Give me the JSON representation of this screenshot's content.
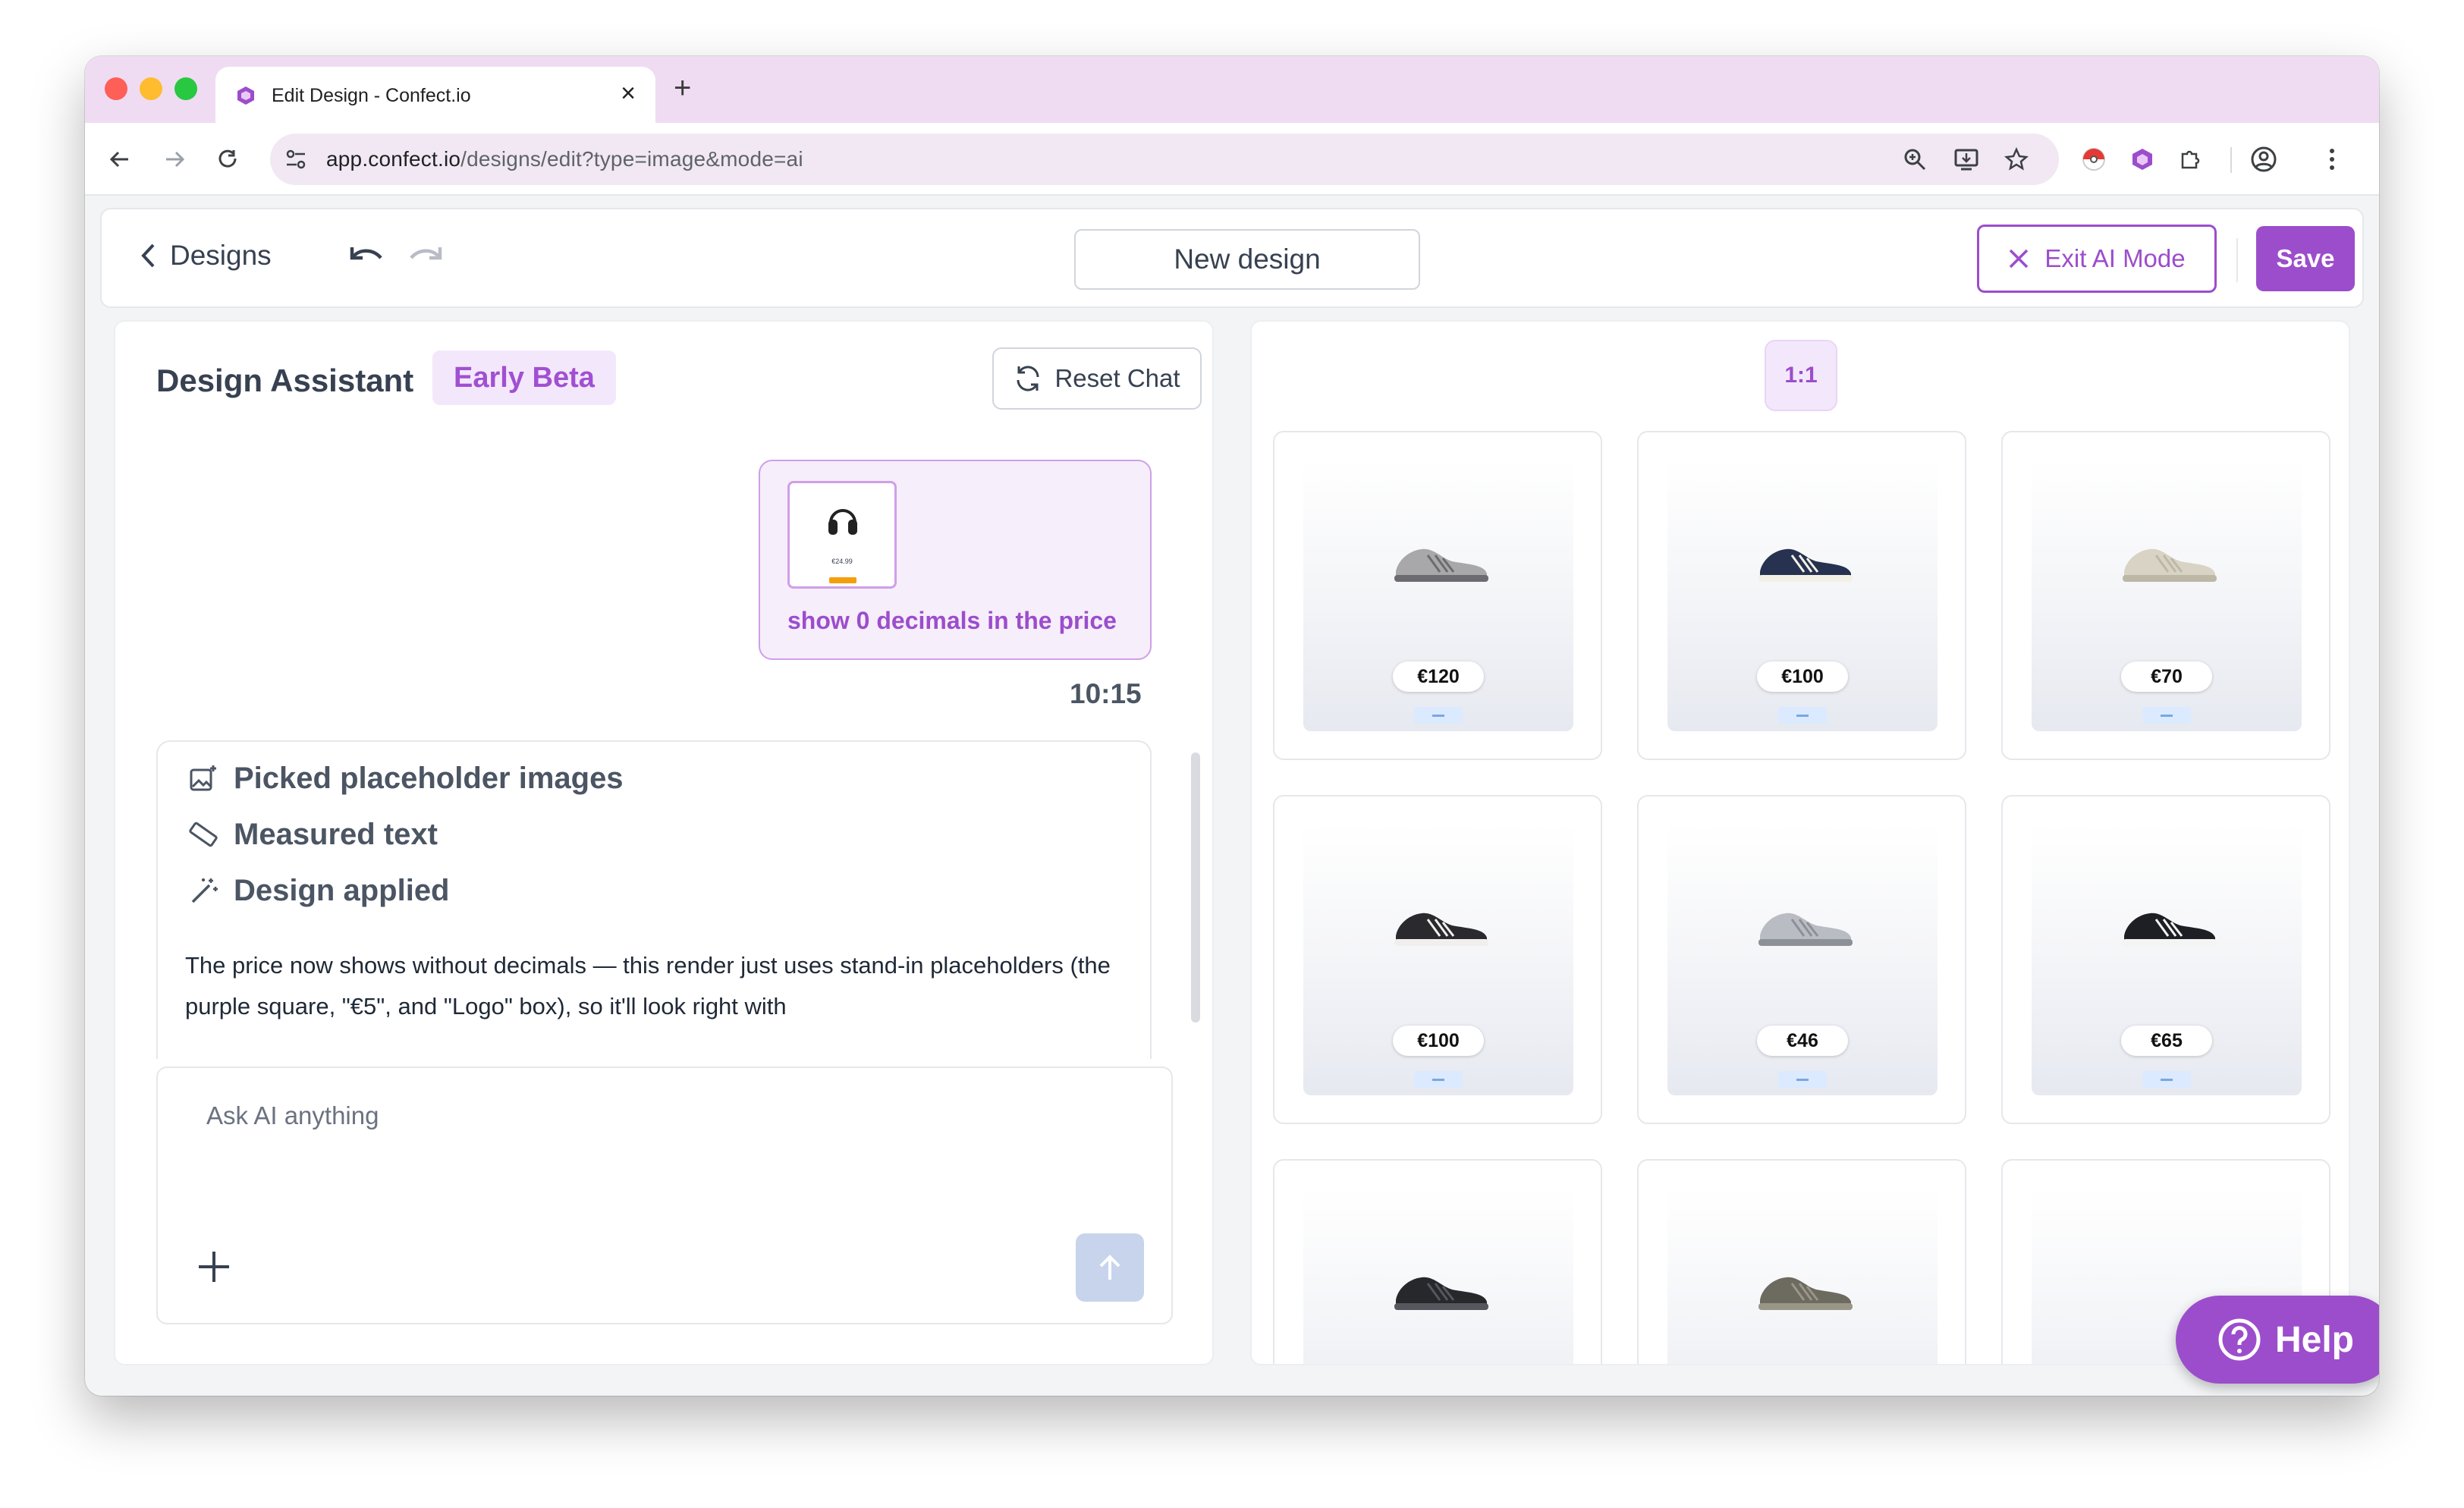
{
  "browser": {
    "tab_title": "Edit Design - Confect.io",
    "url_host": "app.confect.io",
    "url_path": "/designs/edit?type=image&mode=ai"
  },
  "header": {
    "back_label": "Designs",
    "design_name": "New design",
    "exit_ai_label": "Exit AI Mode",
    "save_label": "Save"
  },
  "assistant": {
    "title": "Design Assistant",
    "badge": "Early Beta",
    "reset_label": "Reset Chat",
    "user_message": {
      "text": "show 0 decimals in the price",
      "time": "10:15",
      "thumb_price": "€24.99"
    },
    "steps": [
      "Picked placeholder images",
      "Measured text",
      "Design applied"
    ],
    "response_text": "The price now shows without decimals — this render just uses stand-in placeholders (the purple square, \"€5\", and \"Logo\" box), so it'll look right with",
    "input_placeholder": "Ask AI anything"
  },
  "preview": {
    "ratio": "1:1",
    "products": [
      {
        "price": "€120",
        "shoe_color": "#a8a8ab",
        "accent": "#6b6b70"
      },
      {
        "price": "€100",
        "shoe_color": "#26324f",
        "accent": "#f3f0e6"
      },
      {
        "price": "€70",
        "shoe_color": "#d8d3c4",
        "accent": "#bdb7a6"
      },
      {
        "price": "€100",
        "shoe_color": "#2a2a2e",
        "accent": "#f1eeee"
      },
      {
        "price": "€46",
        "shoe_color": "#b9bcc2",
        "accent": "#8c9097"
      },
      {
        "price": "€65",
        "shoe_color": "#1e1f24",
        "accent": "#f4f4f4"
      },
      {
        "price": "",
        "shoe_color": "#27282c",
        "accent": "#55575e"
      },
      {
        "price": "",
        "shoe_color": "#6d6a60",
        "accent": "#9a9687"
      },
      {
        "price": "",
        "shoe_color": "",
        "accent": ""
      }
    ]
  },
  "help_label": "Help",
  "colors": {
    "brand": "#9c4dcc",
    "brand_light": "#f3e8fb"
  }
}
